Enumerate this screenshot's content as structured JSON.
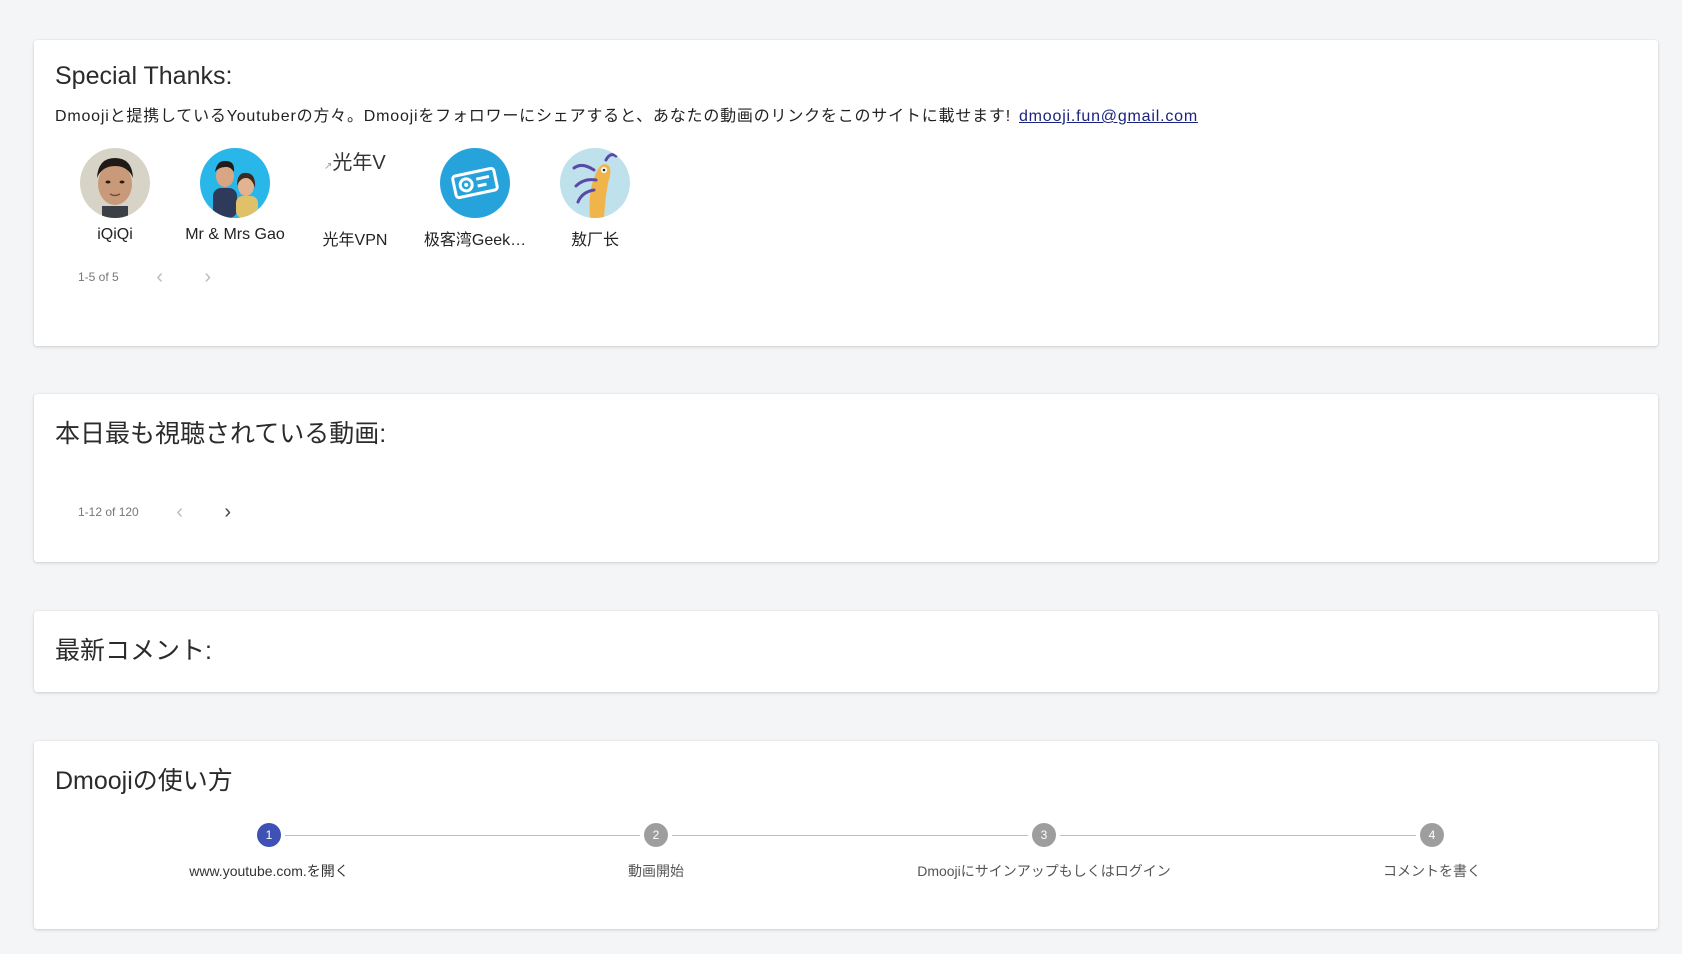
{
  "colors": {
    "background": "#f4f5f7",
    "card": "#ffffff",
    "link": "#1a237e",
    "step_active": "#3f51b5",
    "step_inactive": "#9e9e9e"
  },
  "special_thanks": {
    "title": "Special Thanks:",
    "description": "Dmoojiと提携しているYoutuberの方々。Dmoojiをフォロワーにシェアすると、あなたの動画のリンクをこのサイトに載せます!",
    "email": "dmooji.fun@gmail.com",
    "creators": [
      {
        "name": "iQiQi",
        "icon": "avatar-person-photo"
      },
      {
        "name": "Mr & Mrs Gao",
        "icon": "avatar-couple-photo"
      },
      {
        "name": "光年VPN",
        "icon": "broken-image-icon",
        "alt_text": "光年V"
      },
      {
        "name": "极客湾Geek…",
        "icon": "avatar-blue-gear-logo"
      },
      {
        "name": "敖厂长",
        "icon": "avatar-cartoon-dragon"
      }
    ],
    "pagination": {
      "range": "1-5 of 5",
      "prev_icon": "chevron-left-icon",
      "next_icon": "chevron-right-icon"
    }
  },
  "popular": {
    "title": "本日最も視聴されている動画:",
    "pagination": {
      "range": "1-12 of 120",
      "prev_icon": "chevron-left-icon",
      "next_icon": "chevron-right-icon"
    }
  },
  "comments": {
    "title": "最新コメント:"
  },
  "howto": {
    "title": "Dmoojiの使い方",
    "steps": [
      {
        "number": "1",
        "label": "www.youtube.com.を開く",
        "active": true
      },
      {
        "number": "2",
        "label": "動画開始",
        "active": false
      },
      {
        "number": "3",
        "label": "Dmoojiにサインアップもしくはログイン",
        "active": false
      },
      {
        "number": "4",
        "label": "コメントを書く",
        "active": false
      }
    ]
  }
}
